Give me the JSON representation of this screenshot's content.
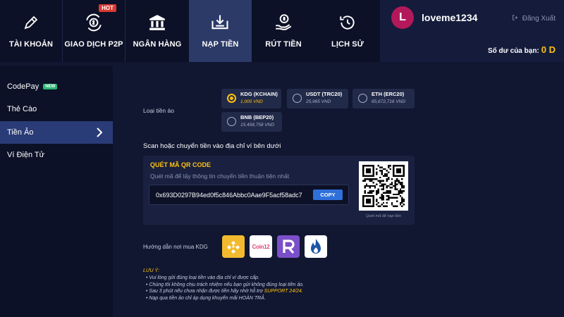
{
  "nav": {
    "items": [
      {
        "label": "TÀI KHOẢN",
        "icon": "pen-icon"
      },
      {
        "label": "GIAO DỊCH P2P",
        "icon": "p2p-exchange-icon",
        "badge": "HOT"
      },
      {
        "label": "NGÂN HÀNG",
        "icon": "bank-icon"
      },
      {
        "label": "NẠP TIỀN",
        "icon": "deposit-icon",
        "active": true
      },
      {
        "label": "RÚT TIỀN",
        "icon": "withdraw-icon"
      },
      {
        "label": "LỊCH SỬ",
        "icon": "history-icon"
      }
    ]
  },
  "user": {
    "avatar_letter": "L",
    "name": "loveme1234",
    "logout": "Đăng Xuất",
    "balance_label": "Số dư của bạn:",
    "balance_value": "0 D"
  },
  "sidebar": {
    "items": [
      {
        "label": "CodePay",
        "badge": "NEW"
      },
      {
        "label": "Thẻ Cào"
      },
      {
        "label": "Tiền Ảo",
        "active": true
      },
      {
        "label": "Ví Điện Tử"
      }
    ]
  },
  "main": {
    "coin_type_label": "Loại tiền ảo",
    "coins": [
      {
        "name": "KDG (KCHAIN)",
        "price": "1,000 VND",
        "selected": true
      },
      {
        "name": "USDT (TRC20)",
        "price": "25,965 VND"
      },
      {
        "name": "ETH (ERC20)",
        "price": "65,672,716 VND"
      },
      {
        "name": "BNB (BEP20)",
        "price": "15,458,758 VND"
      }
    ],
    "scan_text": "Scan hoặc chuyển tiền vào địa chỉ ví bên dưới",
    "qr_title": "QUÉT MÃ QR CODE",
    "qr_desc": "Quét mã để lấy thông tin chuyển tiền thuận tiện nhất",
    "address": "0x693D0297B94ed0f5c846Abbc0Aae9F5acf58adc7",
    "copy_label": "COPY",
    "qr_caption": "Quét mã để nạp tiền",
    "guide_label": "Hướng dẫn nơi mua KDG",
    "exchanges": [
      "binance-logo",
      "coin12-logo",
      "r-exchange-logo",
      "huobi-logo"
    ],
    "exchange_text": {
      "coin12": "Coin12"
    },
    "note_title": "LƯU Ý:",
    "notes": [
      "Vui lòng gửi đúng loại tiền vào địa chỉ ví được cấp.",
      "Chúng tôi không chịu trách nhiệm nếu bạn gửi không đúng loại tiền ảo.",
      "Sau 3 phút nếu chưa nhận được tiền hãy nhờ hỗ trợ ",
      "Nạp qua tiền ảo chỉ áp dụng khuyến mãi HOÀN TRẢ."
    ],
    "support_link": "SUPPORT 24/24."
  },
  "colors": {
    "accent": "#ffc30f",
    "active_nav": "#2b3a67",
    "background": "#111731",
    "copy_button": "#2f6fda"
  }
}
